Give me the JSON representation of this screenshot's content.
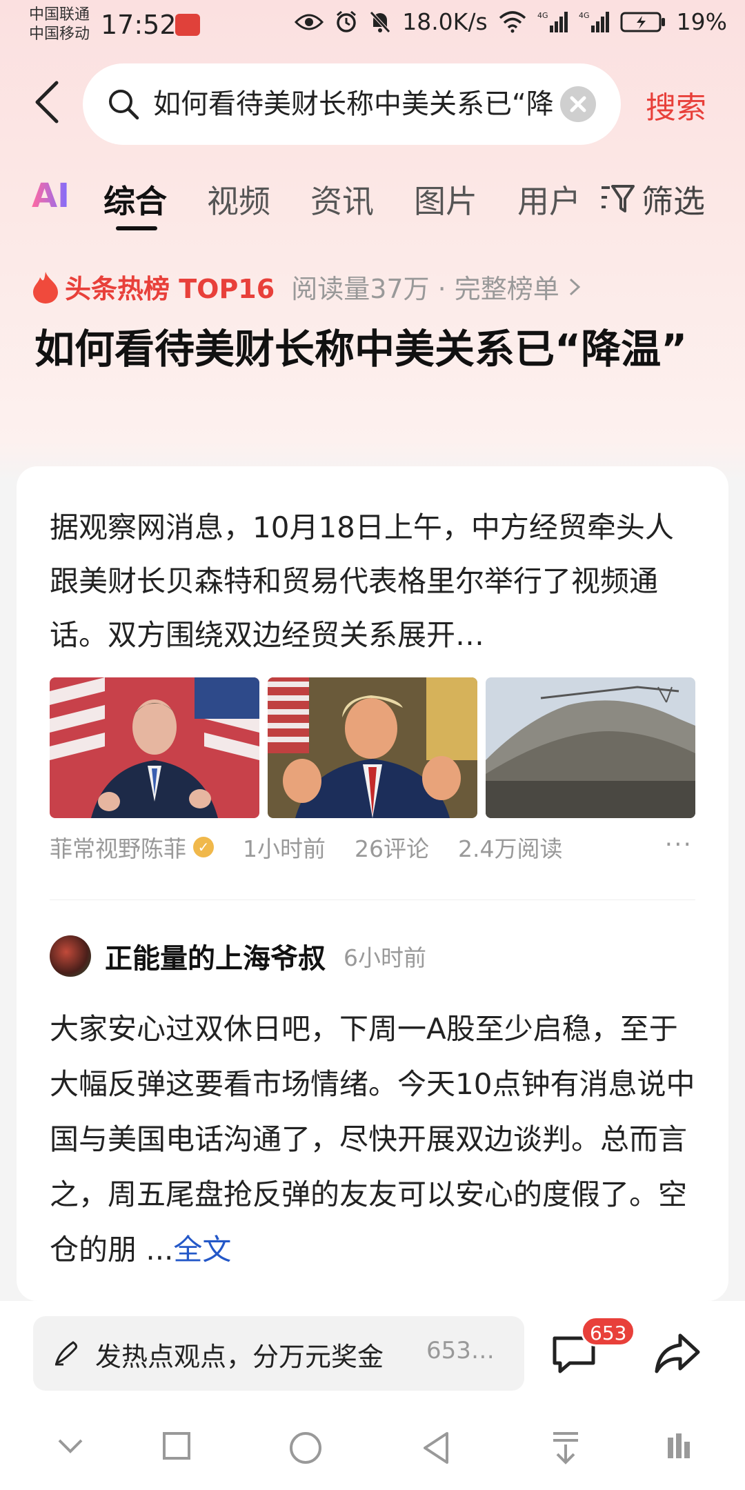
{
  "status_bar": {
    "carrier_1": "中国联通",
    "carrier_2": "中国移动",
    "time": "17:52",
    "network_speed": "18.0K/s",
    "battery": "19%",
    "icons": [
      "eye-icon",
      "alarm-icon",
      "mute-icon",
      "wifi-icon",
      "signal-4g-icon",
      "signal-4g-icon",
      "battery-icon"
    ]
  },
  "search": {
    "query": "如何看待美财长称中美关系已“降温”",
    "submit_label": "搜索"
  },
  "tabs": [
    "AI",
    "综合",
    "视频",
    "资讯",
    "图片",
    "用户"
  ],
  "active_tab": "综合",
  "filter_label": "筛选",
  "hotlist": {
    "title": "头条热榜 TOP16",
    "meta": "阅读量37万 · 完整榜单",
    "headline": "如何看待美财长称中美关系已“降温”"
  },
  "article": {
    "text": "据观察网消息，10月18日上午，中方经贸牵头人跟美财长贝森特和贸易代表格里尔举行了视频通话。双方围绕双边经贸关系展开…",
    "images": [
      "official-at-podium-photo",
      "trump-gesturing-photo",
      "mining-stockpile-photo"
    ],
    "author": "菲常视野陈菲",
    "time": "1小时前",
    "comments": "26评论",
    "reads": "2.4万阅读"
  },
  "post": {
    "author": "正能量的上海爷叔",
    "time": "6小时前",
    "text": "大家安心过双休日吧，下周一A股至少启稳，至于大幅反弹这要看市场情绪。今天10点钟有消息说中国与美国电话沟通了，尽快开展双边谈判。总而言之，周五尾盘抢反弹的友友可以安心的度假了。空仓的朋 ...",
    "read_more": "全文"
  },
  "comment_bar": {
    "placeholder": "发热点观点，分万元奖金",
    "count_preview": "653…",
    "badge": "653"
  },
  "colors": {
    "accent": "#e8403a",
    "link": "#2458c8"
  }
}
